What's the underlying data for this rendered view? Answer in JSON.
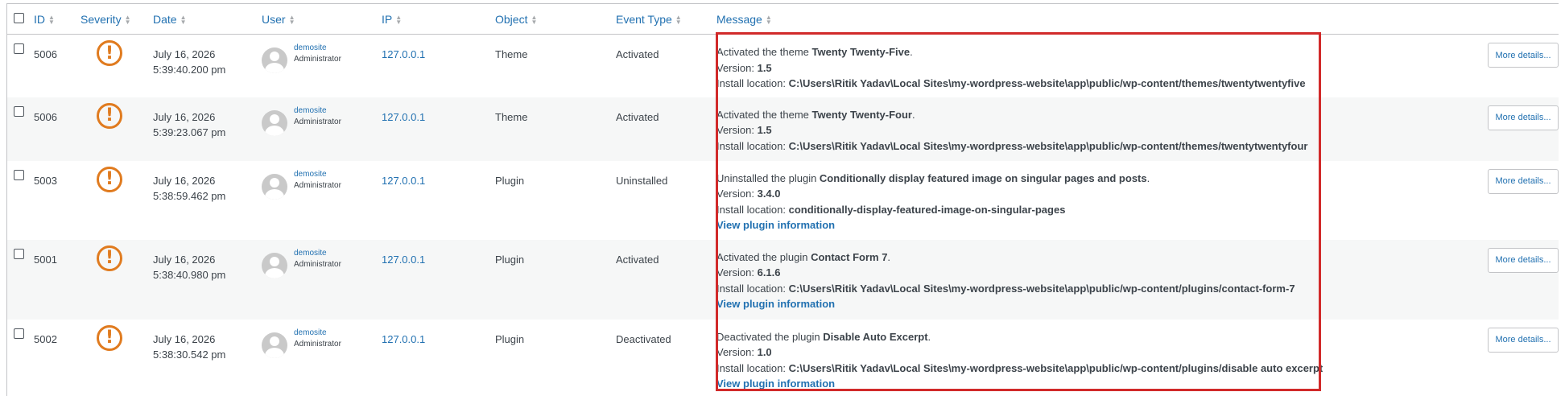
{
  "columns": {
    "id": "ID",
    "severity": "Severity",
    "date": "Date",
    "user": "User",
    "ip": "IP",
    "object": "Object",
    "event_type": "Event Type",
    "message": "Message"
  },
  "icons": {
    "severity": "warning-exclamation-icon",
    "avatar": "user-avatar-icon",
    "sort": "sort-arrows-icon"
  },
  "colors": {
    "severity": "#e07b1f",
    "link": "#2271b1",
    "highlight": "#d12a2a"
  },
  "rows": [
    {
      "id": "5006",
      "date": "July 16, 2026",
      "time": "5:39:40.200 pm",
      "user": "demosite",
      "role": "Administrator",
      "ip": "127.0.0.1",
      "object": "Theme",
      "event": "Activated",
      "msg_prefix": "Activated the theme ",
      "msg_name": "Twenty Twenty-Five",
      "msg_suffix": ".",
      "version_label": "Version: ",
      "version": "1.5",
      "location_label": "Install location: ",
      "location": "C:\\Users\\Ritik Yadav\\Local Sites\\my-wordpress-website\\app\\public/wp-content/themes/twentytwentyfive",
      "more": "More details..."
    },
    {
      "id": "5006",
      "date": "July 16, 2026",
      "time": "5:39:23.067 pm",
      "user": "demosite",
      "role": "Administrator",
      "ip": "127.0.0.1",
      "object": "Theme",
      "event": "Activated",
      "msg_prefix": "Activated the theme ",
      "msg_name": "Twenty Twenty-Four",
      "msg_suffix": ".",
      "version_label": "Version: ",
      "version": "1.5",
      "location_label": "Install location: ",
      "location": "C:\\Users\\Ritik Yadav\\Local Sites\\my-wordpress-website\\app\\public/wp-content/themes/twentytwentyfour",
      "more": "More details..."
    },
    {
      "id": "5003",
      "date": "July 16, 2026",
      "time": "5:38:59.462 pm",
      "user": "demosite",
      "role": "Administrator",
      "ip": "127.0.0.1",
      "object": "Plugin",
      "event": "Uninstalled",
      "msg_prefix": "Uninstalled the plugin ",
      "msg_name": "Conditionally display featured image on singular pages and posts",
      "msg_suffix": ".",
      "version_label": "Version: ",
      "version": "3.4.0",
      "location_label": "Install location: ",
      "location": "conditionally-display-featured-image-on-singular-pages",
      "link": "View plugin information",
      "more": "More details..."
    },
    {
      "id": "5001",
      "date": "July 16, 2026",
      "time": "5:38:40.980 pm",
      "user": "demosite",
      "role": "Administrator",
      "ip": "127.0.0.1",
      "object": "Plugin",
      "event": "Activated",
      "msg_prefix": "Activated the plugin ",
      "msg_name": "Contact Form 7",
      "msg_suffix": ".",
      "version_label": "Version: ",
      "version": "6.1.6",
      "location_label": "Install location: ",
      "location": "C:\\Users\\Ritik Yadav\\Local Sites\\my-wordpress-website\\app\\public/wp-content/plugins/contact-form-7",
      "link": "View plugin information",
      "more": "More details..."
    },
    {
      "id": "5002",
      "date": "July 16, 2026",
      "time": "5:38:30.542 pm",
      "user": "demosite",
      "role": "Administrator",
      "ip": "127.0.0.1",
      "object": "Plugin",
      "event": "Deactivated",
      "msg_prefix": "Deactivated the plugin ",
      "msg_name": "Disable Auto Excerpt",
      "msg_suffix": ".",
      "version_label": "Version: ",
      "version": "1.0",
      "location_label": "Install location: ",
      "location": "C:\\Users\\Ritik Yadav\\Local Sites\\my-wordpress-website\\app\\public/wp-content/plugins/disable auto excerpt",
      "link": "View plugin information",
      "more": "More details..."
    }
  ]
}
